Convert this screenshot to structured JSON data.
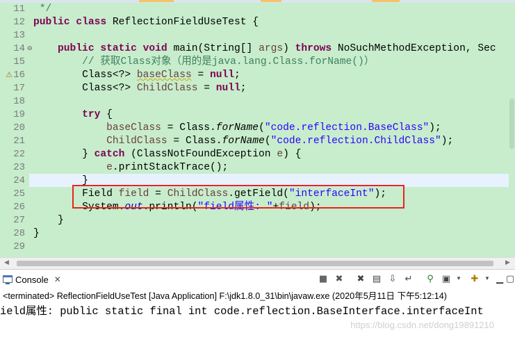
{
  "editor": {
    "lines": [
      {
        "n": "11",
        "fold": "",
        "warn": false
      },
      {
        "n": "12",
        "fold": "",
        "warn": false
      },
      {
        "n": "13",
        "fold": "",
        "warn": false
      },
      {
        "n": "14",
        "fold": "⊖",
        "warn": false
      },
      {
        "n": "15",
        "fold": "",
        "warn": false
      },
      {
        "n": "16",
        "fold": "",
        "warn": true
      },
      {
        "n": "17",
        "fold": "",
        "warn": false
      },
      {
        "n": "18",
        "fold": "",
        "warn": false
      },
      {
        "n": "19",
        "fold": "",
        "warn": false
      },
      {
        "n": "20",
        "fold": "",
        "warn": false
      },
      {
        "n": "21",
        "fold": "",
        "warn": false
      },
      {
        "n": "22",
        "fold": "",
        "warn": false
      },
      {
        "n": "23",
        "fold": "",
        "warn": false
      },
      {
        "n": "24",
        "fold": "",
        "warn": false
      },
      {
        "n": "25",
        "fold": "",
        "warn": false
      },
      {
        "n": "26",
        "fold": "",
        "warn": false
      },
      {
        "n": "27",
        "fold": "",
        "warn": false
      },
      {
        "n": "28",
        "fold": "",
        "warn": false
      },
      {
        "n": "29",
        "fold": "",
        "warn": false
      }
    ],
    "code": {
      "l11": " */",
      "l12_kw1": "public",
      "l12_kw2": "class",
      "l12_rest": " ReflectionFieldUseTest {",
      "l14_kw1": "public",
      "l14_kw2": "static",
      "l14_kw3": "void",
      "l14_mid": " main(String[] ",
      "l14_args": "args",
      "l14_kw4": "throws",
      "l14_rest": " NoSuchMethodException, Sec",
      "l15_comment": "// 获取Class对象（用的是java.lang.Class.forName()）",
      "l16_a": "Class<?> ",
      "l16_var": "baseClass",
      "l16_b": " = ",
      "l16_null": "null",
      "l16_c": ";",
      "l17_a": "Class<?> ",
      "l17_var": "ChildClass",
      "l17_b": " = ",
      "l17_null": "null",
      "l17_c": ";",
      "l19_kw": "try",
      "l19_rest": " {",
      "l20_var": "baseClass",
      "l20_a": " = Class.",
      "l20_m": "forName",
      "l20_b": "(",
      "l20_str": "\"code.reflection.BaseClass\"",
      "l20_c": ");",
      "l21_var": "ChildClass",
      "l21_a": " = Class.",
      "l21_m": "forName",
      "l21_b": "(",
      "l21_str": "\"code.reflection.ChildClass\"",
      "l21_c": ");",
      "l22_a": "} ",
      "l22_kw": "catch",
      "l22_b": " (ClassNotFoundException ",
      "l22_e": "e",
      "l22_c": ") {",
      "l23_e": "e",
      "l23_rest": ".printStackTrace();",
      "l24": "}",
      "l25_a": "Field ",
      "l25_var": "field",
      "l25_b": " = ",
      "l25_cc": "ChildClass",
      "l25_c": ".getField(",
      "l25_str": "\"interfaceInt\"",
      "l25_d": ");",
      "l26_a": "System.",
      "l26_out": "out",
      "l26_b": ".println(",
      "l26_str": "\"field属性: \"",
      "l26_c": "+",
      "l26_var": "field",
      "l26_d": ");",
      "l27": "}",
      "l28": "}"
    }
  },
  "console": {
    "tab_label": "Console",
    "terminated": "<terminated> ReflectionFieldUseTest [Java Application] F:\\jdk1.8.0_31\\bin\\javaw.exe (2020年5月11日 下午5:12:14)",
    "output": "ield属性: public static final int code.reflection.BaseInterface.interfaceInt",
    "watermark": "https://blog.csdn.net/dong19891210"
  },
  "colors": {
    "editor_bg": "#c7edcc",
    "keyword": "#7f0055",
    "comment": "#3f7f5f",
    "field": "#0000c0",
    "string": "#2a00ff",
    "highlight_box": "#e8231d"
  }
}
